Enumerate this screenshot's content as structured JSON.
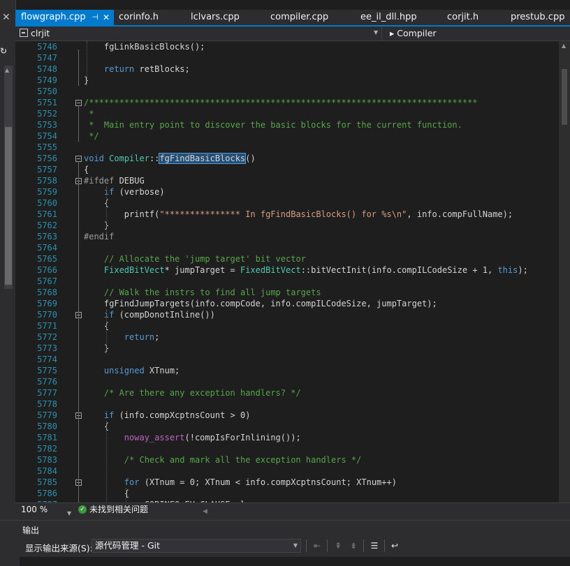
{
  "tabs": [
    {
      "label": "flowgraph.cpp",
      "active": true
    },
    {
      "label": "corinfo.h"
    },
    {
      "label": "lclvars.cpp"
    },
    {
      "label": "compiler.cpp"
    },
    {
      "label": "ee_il_dll.hpp"
    },
    {
      "label": "corjit.h"
    },
    {
      "label": "prestub.cpp"
    }
  ],
  "navbar": {
    "project": "clrjit",
    "scope": "Compiler"
  },
  "status": {
    "zoom": "100 %",
    "issues": "未找到相关问题"
  },
  "output": {
    "title": "输出",
    "source_label": "显示输出来源(S):",
    "source_value": "源代码管理 - Git"
  },
  "code_lines": [
    {
      "n": "5746",
      "html": "    fgLinkBasicBlocks();"
    },
    {
      "n": "5747",
      "html": ""
    },
    {
      "n": "5748",
      "html": "    <span class='kw'>return</span> retBlocks;"
    },
    {
      "n": "5749",
      "html": "}"
    },
    {
      "n": "5750",
      "html": ""
    },
    {
      "n": "5751",
      "html": "<span class='cm'>/*****************************************************************************</span>"
    },
    {
      "n": "5752",
      "html": "<span class='cm'> *</span>"
    },
    {
      "n": "5753",
      "html": "<span class='cm'> *  Main entry point to discover the basic blocks for the current function.</span>"
    },
    {
      "n": "5754",
      "html": "<span class='cm'> */</span>"
    },
    {
      "n": "5755",
      "html": ""
    },
    {
      "n": "5756",
      "html": "<span class='kw'>void</span> <span class='ty'>Compiler</span>::<span class='hl'>fgFindBasicBlocks</span>()"
    },
    {
      "n": "5757",
      "html": "{"
    },
    {
      "n": "5758",
      "html": "<span class='pp'>#ifdef</span> DEBUG"
    },
    {
      "n": "5759",
      "html": "    <span class='kw'>if</span> (verbose)"
    },
    {
      "n": "5760",
      "html": "    {"
    },
    {
      "n": "5761",
      "html": "        printf(<span class='st'>\"*************** In fgFindBasicBlocks() for %s\\n\"</span>, info.compFullName);"
    },
    {
      "n": "5762",
      "html": "    }"
    },
    {
      "n": "5763",
      "html": "<span class='pp'>#endif</span>"
    },
    {
      "n": "5764",
      "html": ""
    },
    {
      "n": "5765",
      "html": "    <span class='cm'>// Allocate the 'jump target' bit vector</span>"
    },
    {
      "n": "5766",
      "html": "    <span class='ty'>FixedBitVect</span>* jumpTarget = <span class='ty'>FixedBitVect</span>::bitVectInit(info.compILCodeSize + 1, <span class='kw'>this</span>);"
    },
    {
      "n": "5767",
      "html": ""
    },
    {
      "n": "5768",
      "html": "    <span class='cm'>// Walk the instrs to find all jump targets</span>"
    },
    {
      "n": "5769",
      "html": "    fgFindJumpTargets(info.compCode, info.compILCodeSize, jumpTarget);"
    },
    {
      "n": "5770",
      "html": "    <span class='kw'>if</span> (compDonotInline())"
    },
    {
      "n": "5771",
      "html": "    {"
    },
    {
      "n": "5772",
      "html": "        <span class='kw'>return</span>;"
    },
    {
      "n": "5773",
      "html": "    }"
    },
    {
      "n": "5774",
      "html": ""
    },
    {
      "n": "5775",
      "html": "    <span class='kw'>unsigned</span> XTnum;"
    },
    {
      "n": "5776",
      "html": ""
    },
    {
      "n": "5777",
      "html": "    <span class='cm'>/* Are there any exception handlers? */</span>"
    },
    {
      "n": "5778",
      "html": ""
    },
    {
      "n": "5779",
      "html": "    <span class='kw'>if</span> (info.compXcptnsCount &gt; 0)"
    },
    {
      "n": "5780",
      "html": "    {"
    },
    {
      "n": "5781",
      "html": "        <span class='mc'>noway_assert</span>(!compIsForInlining());"
    },
    {
      "n": "5782",
      "html": ""
    },
    {
      "n": "5783",
      "html": "        <span class='cm'>/* Check and mark all the exception handlers */</span>"
    },
    {
      "n": "5784",
      "html": ""
    },
    {
      "n": "5785",
      "html": "        <span class='kw'>for</span> (XTnum = 0; XTnum &lt; info.compXcptnsCount; XTnum++)"
    },
    {
      "n": "5786",
      "html": "        {"
    },
    {
      "n": "5787",
      "html": "            <span class='mr'>CORINFO_EH_CLAUSE clause;</span>"
    }
  ],
  "folds": [
    "5751",
    "5756",
    "5758",
    "5770",
    "5779",
    "5785"
  ]
}
